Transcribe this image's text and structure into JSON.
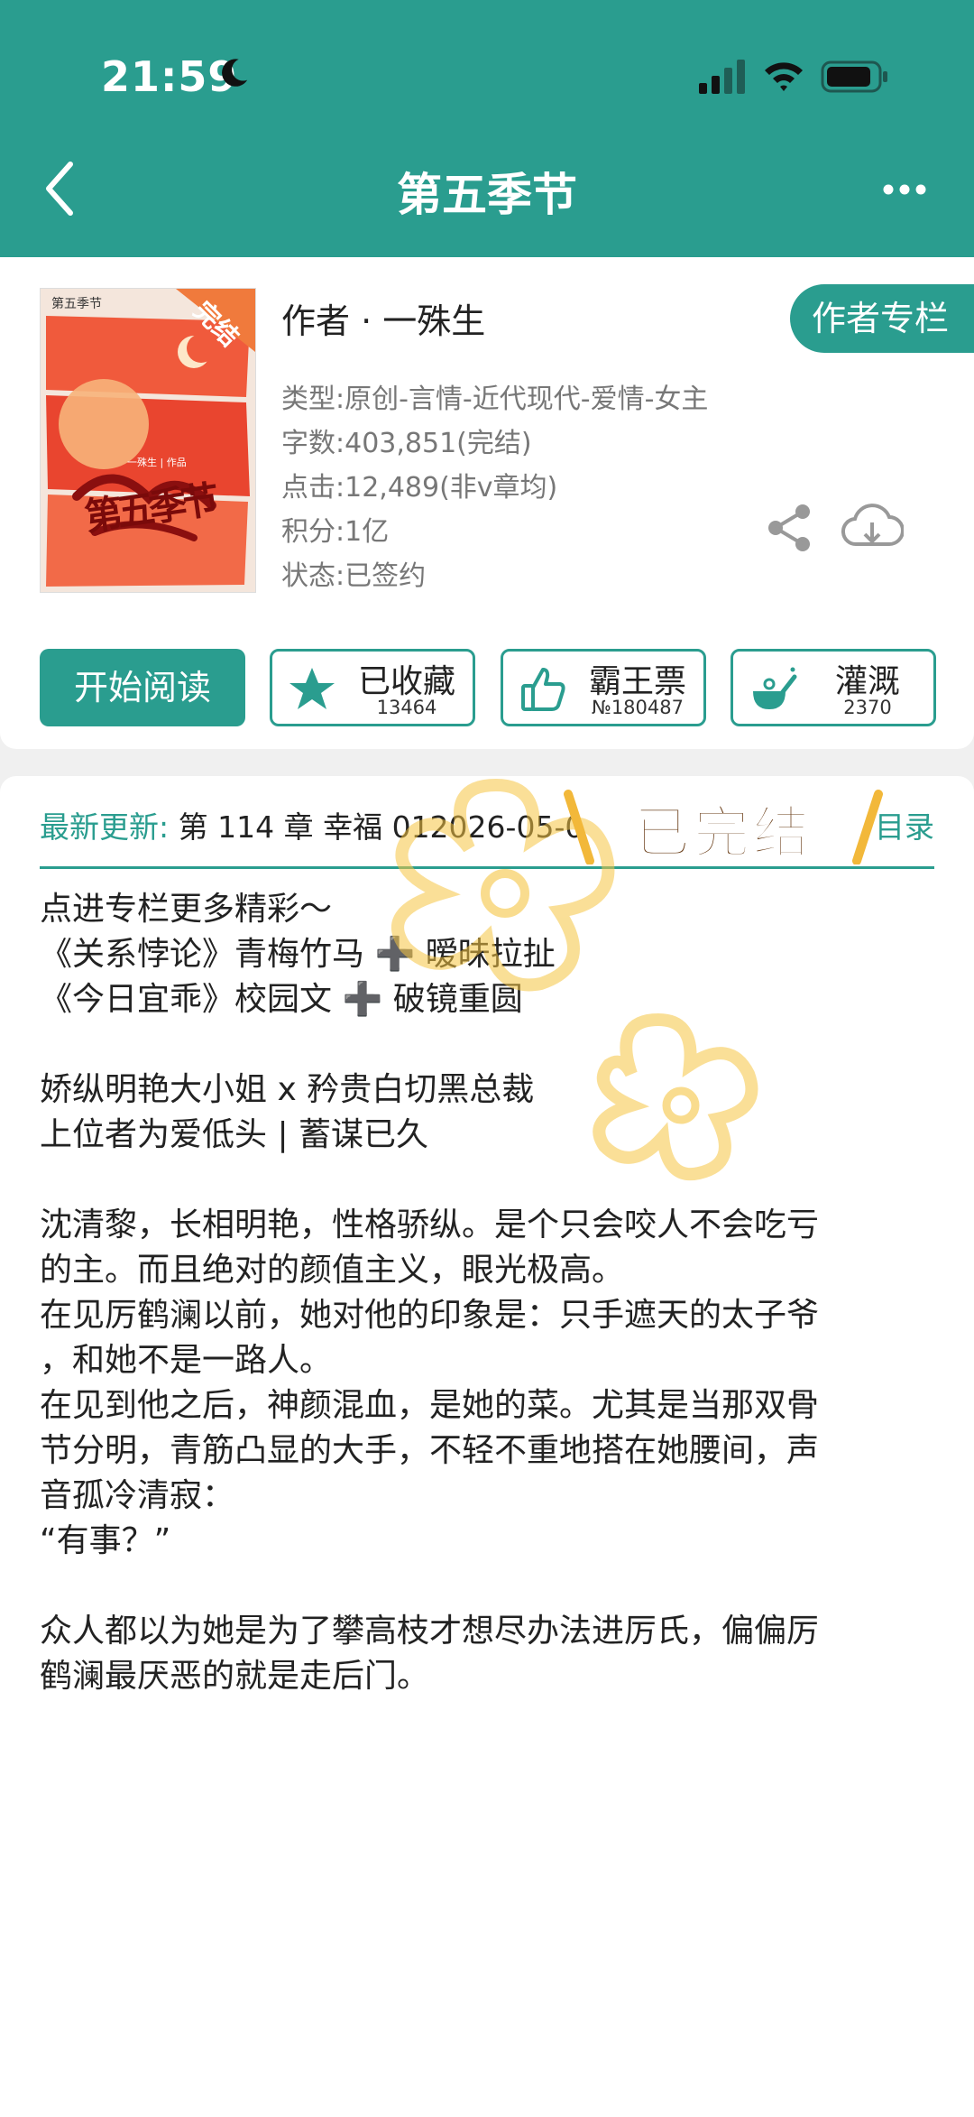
{
  "status_bar": {
    "time": "21:59"
  },
  "nav": {
    "title": "第五季节"
  },
  "book": {
    "cover_title": "第五季节",
    "cover_author": "一殊生 | 作品",
    "cover_badge": "完结",
    "cover_big_text": "第五季节",
    "author_line": "作者 · 一殊生",
    "author_column": "作者专栏",
    "type": "类型:原创-言情-近代现代-爱情-女主",
    "words": "字数:403,851(完结)",
    "clicks": "点击:12,489(非v章均)",
    "points": "积分:1亿",
    "status": "状态:已签约"
  },
  "actions": {
    "read": "开始阅读",
    "favorite": {
      "label": "已收藏",
      "count": "13464"
    },
    "ticket": {
      "label": "霸王票",
      "count": "№180487"
    },
    "water": {
      "label": "灌溉",
      "count": "2370"
    }
  },
  "latest": {
    "label": "最新更新:",
    "text": "第 114 章 幸福 012026-05-0",
    "catalog": "目录"
  },
  "sticker": {
    "text": "已完结"
  },
  "description": [
    "点进专栏更多精彩～",
    "《关系悖论》青梅竹马 ➕ 暧昧拉扯",
    "《今日宜乖》校园文 ➕ 破镜重圆",
    "",
    "娇纵明艳大小姐 x 矜贵白切黑总裁",
    "上位者为爱低头 | 蓄谋已久",
    "",
    "沈清黎，长相明艳，性格骄纵。是个只会咬人不会吃亏",
    "的主。而且绝对的颜值主义，眼光极高。",
    "在见厉鹤澜以前，她对他的印象是：只手遮天的太子爷",
    "，和她不是一路人。",
    "在见到他之后，神颜混血，是她的菜。尤其是当那双骨",
    "节分明，青筋凸显的大手，不轻不重地搭在她腰间，声",
    "音孤冷清寂：",
    "“有事？”",
    "",
    "众人都以为她是为了攀高枝才想尽办法进厉氏，偏偏厉",
    "鹤澜最厌恶的就是走后门。"
  ],
  "colors": {
    "accent": "#2a9d8f",
    "sticker": "#f5c542"
  }
}
